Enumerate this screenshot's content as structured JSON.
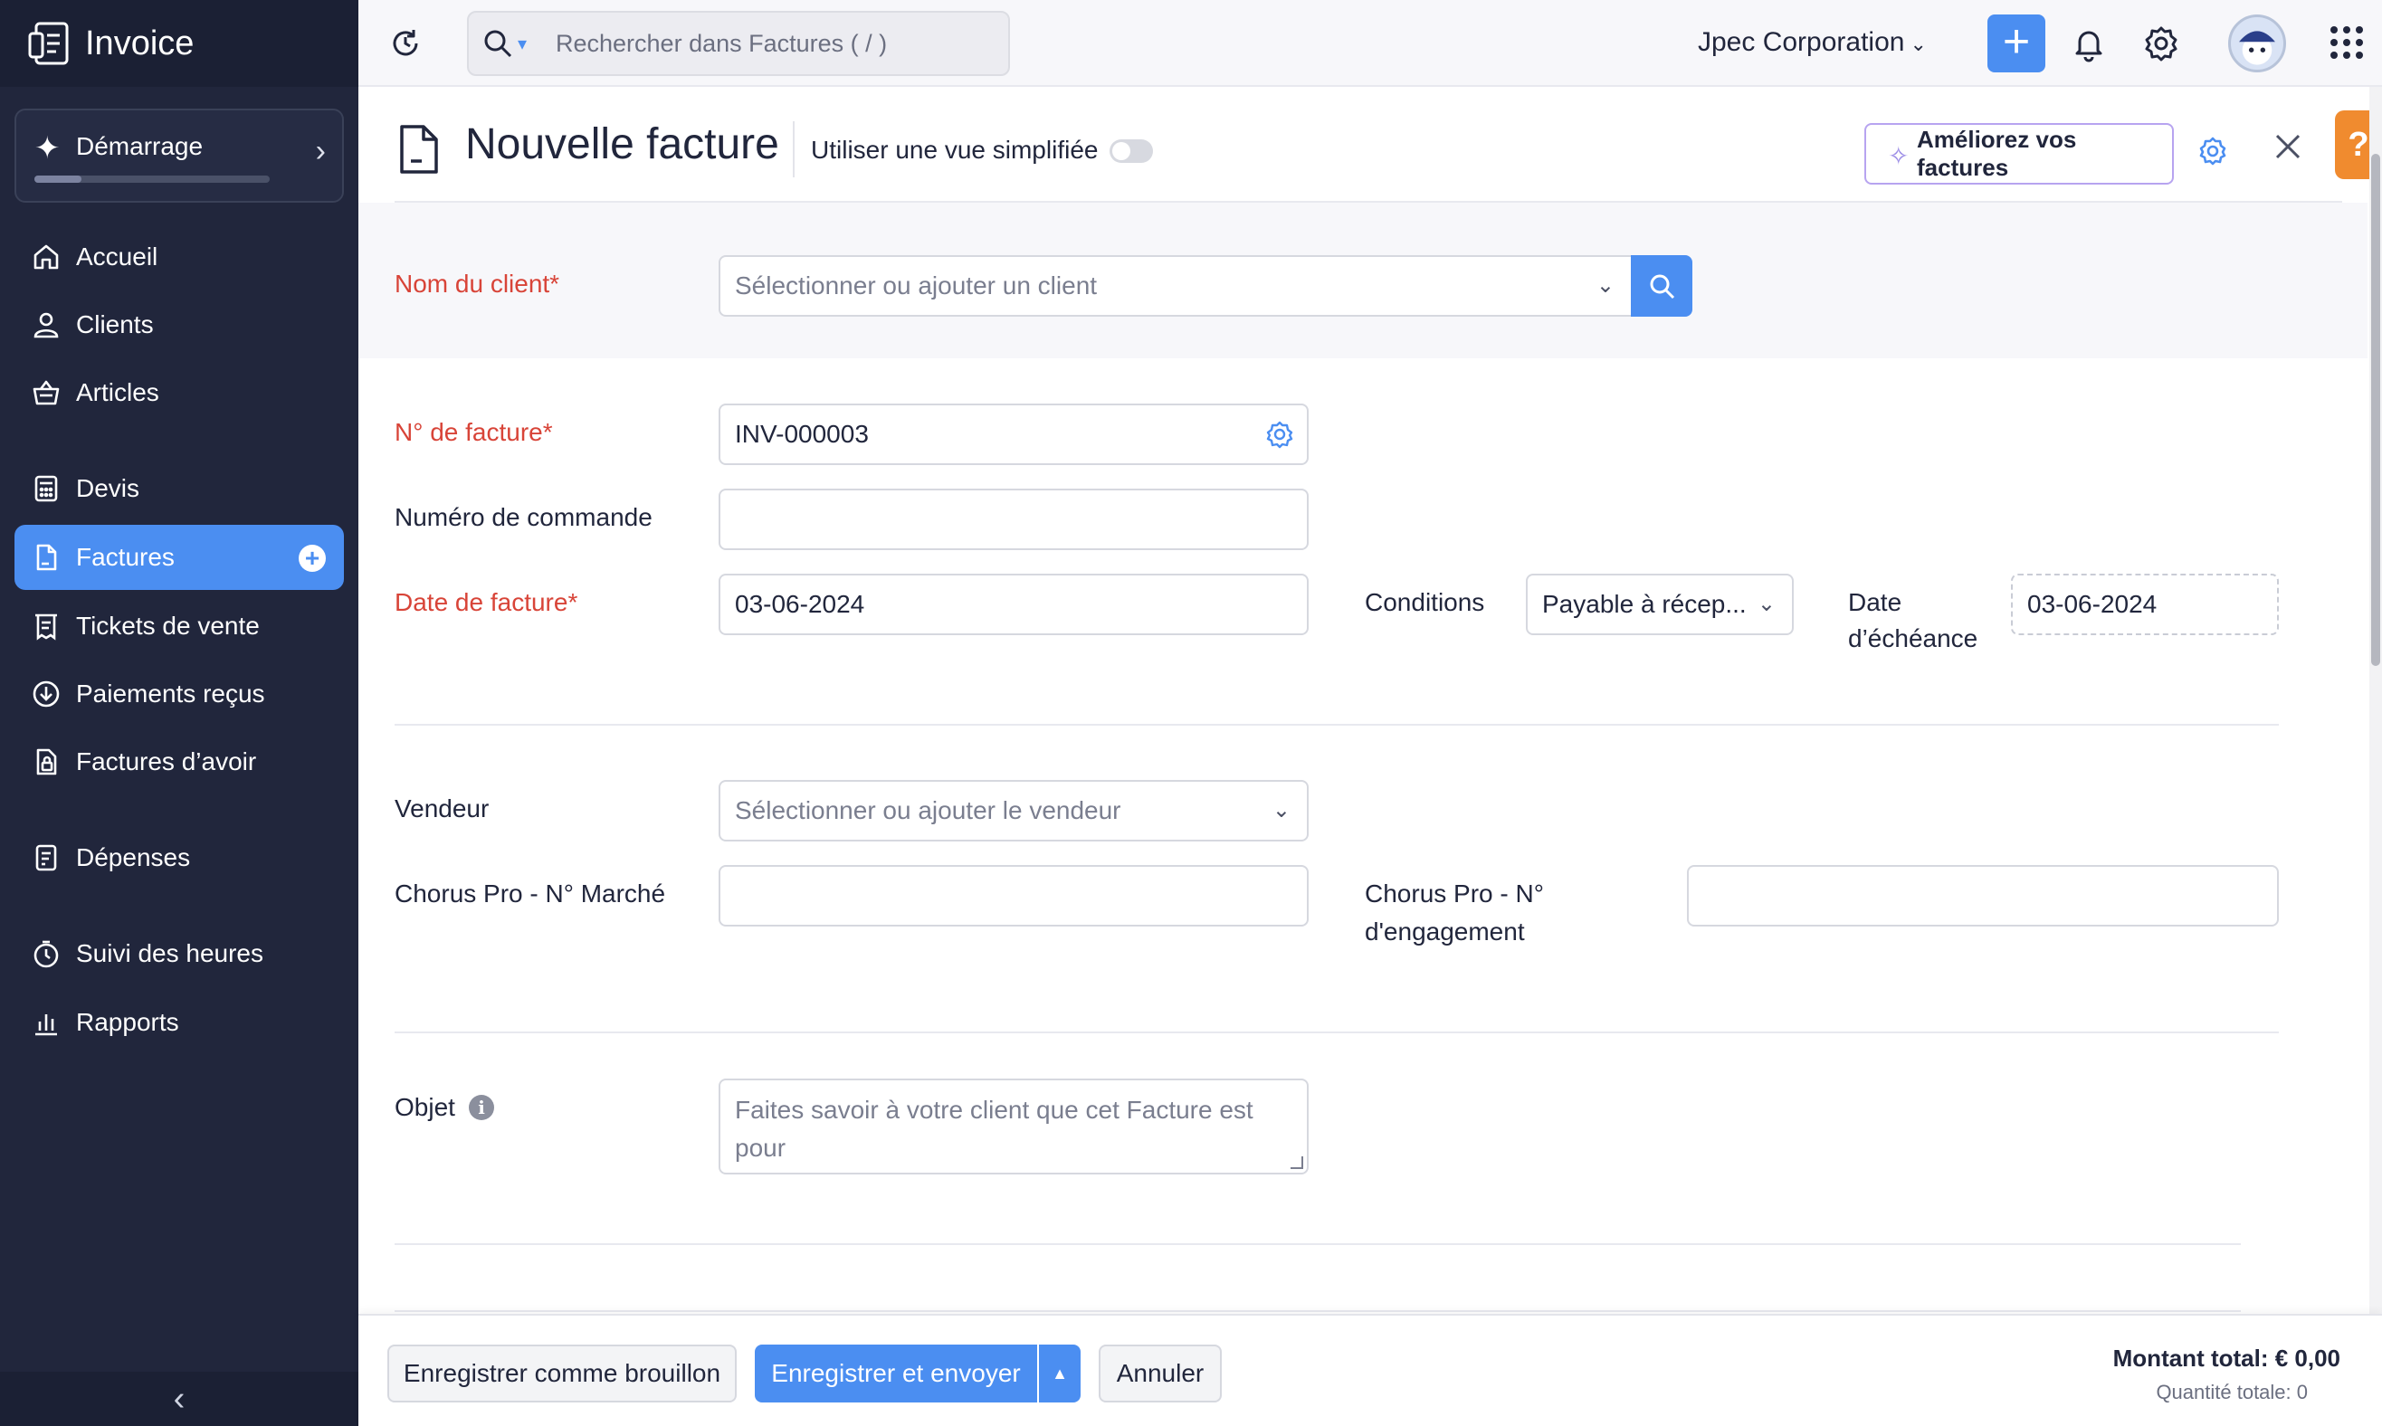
{
  "app": {
    "name": "Invoice"
  },
  "sidebar": {
    "starter": {
      "label": "Démarrage",
      "progress": 0.2
    },
    "items": [
      {
        "id": "home",
        "label": "Accueil"
      },
      {
        "id": "clients",
        "label": "Clients"
      },
      {
        "id": "articles",
        "label": "Articles"
      },
      {
        "id": "quotes",
        "label": "Devis"
      },
      {
        "id": "invoices",
        "label": "Factures",
        "active": true
      },
      {
        "id": "sales-receipts",
        "label": "Tickets de vente"
      },
      {
        "id": "payments",
        "label": "Paiements reçus"
      },
      {
        "id": "credit-notes",
        "label": "Factures d’avoir"
      },
      {
        "id": "expenses",
        "label": "Dépenses"
      },
      {
        "id": "time",
        "label": "Suivi des heures"
      },
      {
        "id": "reports",
        "label": "Rapports"
      }
    ]
  },
  "topbar": {
    "search_placeholder": "Rechercher dans Factures ( / )",
    "organization": "Jpec Corporation"
  },
  "header": {
    "title": "Nouvelle facture",
    "simplified_view_label": "Utiliser une vue simplifiée",
    "simplified_view_on": false,
    "improve_label": "Améliorez vos factures",
    "help_label": "?"
  },
  "form": {
    "client": {
      "label": "Nom du client*",
      "placeholder": "Sélectionner ou ajouter un client"
    },
    "invoice_number": {
      "label": "N° de facture*",
      "value": "INV-000003"
    },
    "order_number": {
      "label": "Numéro de commande",
      "value": ""
    },
    "invoice_date": {
      "label": "Date de facture*",
      "value": "03-06-2024"
    },
    "terms": {
      "label": "Conditions",
      "value": "Payable à récep..."
    },
    "due_date": {
      "label_line1": "Date",
      "label_line2": "d’échéance",
      "value": "03-06-2024"
    },
    "salesperson": {
      "label": "Vendeur",
      "placeholder": "Sélectionner ou ajouter le vendeur"
    },
    "chorus_market": {
      "label": "Chorus Pro - N° Marché",
      "value": ""
    },
    "chorus_engagement": {
      "label_line1": "Chorus Pro - N°",
      "label_line2": "d'engagement",
      "value": ""
    },
    "subject": {
      "label": "Objet",
      "placeholder": "Faites savoir à votre client que cet Facture est pour"
    }
  },
  "footer": {
    "save_draft": "Enregistrer comme brouillon",
    "save_send": "Enregistrer et envoyer",
    "cancel": "Annuler",
    "total_amount": "Montant total: € 0,00",
    "total_quantity": "Quantité totale: 0"
  },
  "colors": {
    "sidebar_bg": "#21263c",
    "accent": "#4b8ef1",
    "required": "#d84438",
    "help": "#f08b2f"
  }
}
